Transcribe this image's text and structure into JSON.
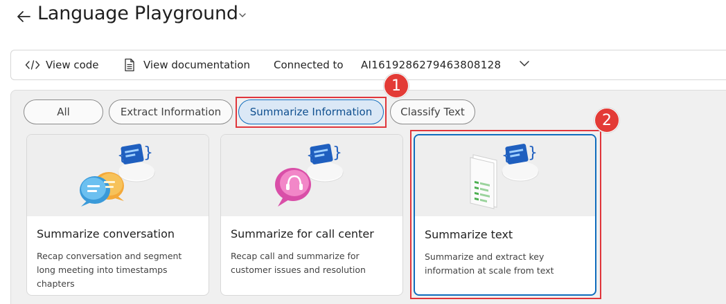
{
  "header": {
    "title": "Language Playground"
  },
  "toolbar": {
    "view_code_label": "View code",
    "view_docs_label": "View documentation",
    "connected_label": "Connected to",
    "connected_value": "AI1619286279463808128"
  },
  "filters": [
    {
      "label": "All",
      "active": false
    },
    {
      "label": "Extract Information",
      "active": false
    },
    {
      "label": "Summarize Information",
      "active": true
    },
    {
      "label": "Classify Text",
      "active": false
    }
  ],
  "annotations": [
    "1",
    "2"
  ],
  "cards": [
    {
      "title": "Summarize conversation",
      "description": "Recap conversation and segment long meeting into timestamps chapters",
      "icon": "chat-bubbles-icon",
      "selected": false
    },
    {
      "title": "Summarize for call center",
      "description": "Recap call and summarize for customer issues and resolution",
      "icon": "headset-icon",
      "selected": false
    },
    {
      "title": "Summarize text",
      "description": "Summarize and extract key information at scale from text",
      "icon": "document-icon",
      "selected": true
    }
  ],
  "colors": {
    "accent": "#0f6cbd",
    "highlight": "#e0353b",
    "panel_bg": "#f0f0f0"
  }
}
